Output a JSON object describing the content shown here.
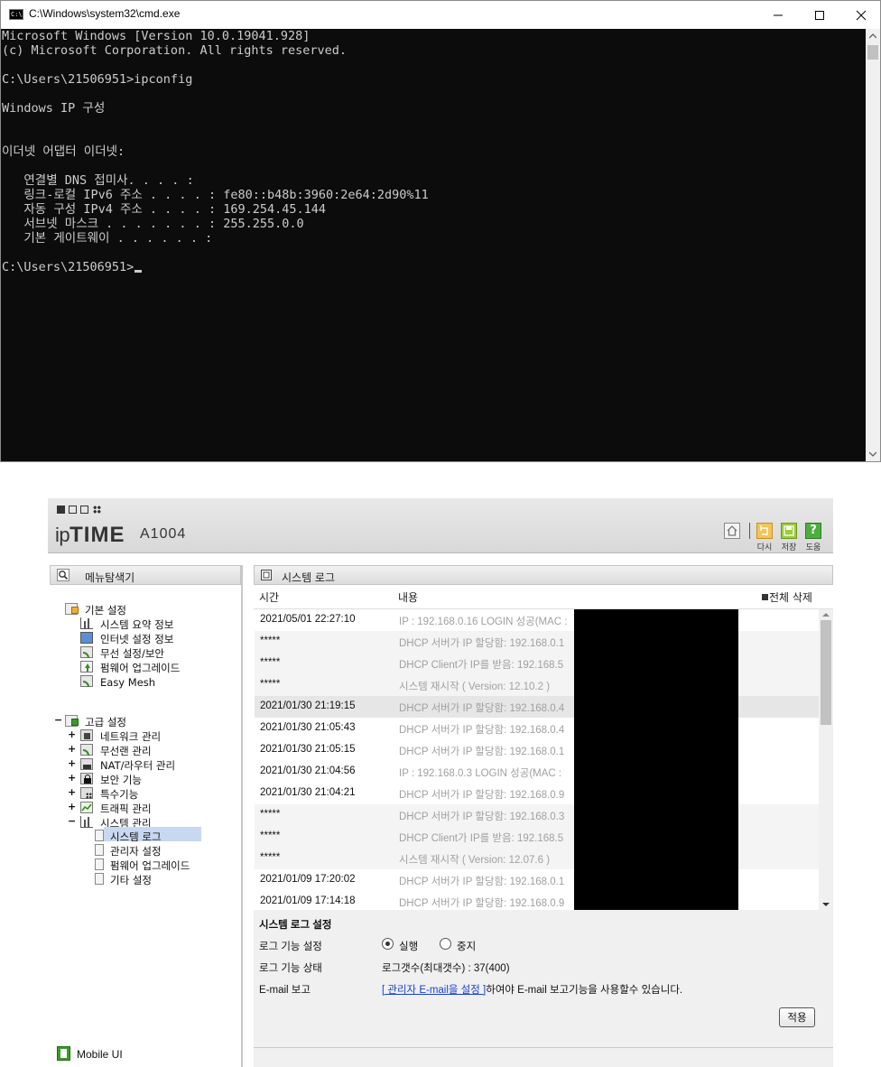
{
  "cmd": {
    "title": "C:\\Windows\\system32\\cmd.exe",
    "app_icon_text": "C:\\",
    "lines": [
      "Microsoft Windows [Version 10.0.19041.928]",
      "(c) Microsoft Corporation. All rights reserved.",
      "",
      "C:\\Users\\21506951>ipconfig",
      "",
      "Windows IP 구성",
      "",
      "",
      "이더넷 어댑터 이더넷:",
      "",
      "   연결별 DNS 접미사. . . . :",
      "   링크-로컬 IPv6 주소 . . . . : fe80::b48b:3960:2e64:2d90%11",
      "   자동 구성 IPv4 주소 . . . . : 169.254.45.144",
      "   서브넷 마스크 . . . . . . . : 255.255.0.0",
      "   기본 게이트웨이 . . . . . . :",
      ""
    ],
    "prompt": "C:\\Users\\21506951>"
  },
  "router": {
    "brand": "ipTIME",
    "brand_prefix": "ip",
    "brand_main": "TIME",
    "model": "A1004",
    "header_buttons": [
      "다시",
      "저장",
      "도움"
    ],
    "menu_title": "메뉴탐색기",
    "tree": {
      "basic": {
        "label": "기본 설정",
        "items": [
          "시스템 요약 정보",
          "인터넷 설정 정보",
          "무선 설정/보안",
          "펌웨어 업그레이드",
          "Easy Mesh"
        ]
      },
      "advanced": {
        "label": "고급 설정",
        "items": [
          "네트워크 관리",
          "무선랜 관리",
          "NAT/라우터 관리",
          "보안 기능",
          "특수기능",
          "트래픽 관리",
          "시스템 관리"
        ],
        "system_sub": [
          "시스템 로그",
          "관리자 설정",
          "펌웨어 업그레이드",
          "기타 설정"
        ]
      }
    },
    "mobile_ui": "Mobile UI",
    "log_title": "시스템 로그",
    "col_time": "시간",
    "col_content": "내용",
    "delete_all": "전체 삭제",
    "logs": [
      {
        "time": "2021/05/01 22:27:10",
        "msg": "IP : 192.168.0.16 LOGIN 성공(MAC :"
      },
      {
        "time": "*****",
        "msg": "DHCP 서버가 IP 할당함: 192.168.0.1"
      },
      {
        "time": "*****",
        "msg": "DHCP Client가 IP를 받음: 192.168.5"
      },
      {
        "time": "*****",
        "msg": "시스템 재시작 ( Version: 12.10.2 )"
      },
      {
        "time": "2021/01/30 21:19:15",
        "msg": "DHCP 서버가 IP 할당함: 192.168.0.4"
      },
      {
        "time": "2021/01/30 21:05:43",
        "msg": "DHCP 서버가 IP 할당함: 192.168.0.4"
      },
      {
        "time": "2021/01/30 21:05:15",
        "msg": "DHCP 서버가 IP 할당함: 192.168.0.1"
      },
      {
        "time": "2021/01/30 21:04:56",
        "msg": "IP : 192.168.0.3 LOGIN 성공(MAC :"
      },
      {
        "time": "2021/01/30 21:04:21",
        "msg": "DHCP 서버가 IP 할당함: 192.168.0.9"
      },
      {
        "time": "*****",
        "msg": "DHCP 서버가 IP 할당함: 192.168.0.3"
      },
      {
        "time": "*****",
        "msg": "DHCP Client가 IP를 받음: 192.168.5"
      },
      {
        "time": "*****",
        "msg": "시스템 재시작 ( Version: 12.07.6 )"
      },
      {
        "time": "2021/01/09 17:20:02",
        "msg": "DHCP 서버가 IP 할당함: 192.168.0.1"
      },
      {
        "time": "2021/01/09 17:14:18",
        "msg": "DHCP 서버가 IP 할당함: 192.168.0.9"
      }
    ],
    "settings": {
      "title": "시스템 로그 설정",
      "func_label": "로그 기능 설정",
      "run_label": "실행",
      "stop_label": "중지",
      "status_label": "로그 기능 상태",
      "status_value": "로그갯수(최대갯수) : 37(400)",
      "email_label": "E-mail 보고",
      "email_link": "[ 관리자 E-mail을 설정 ]",
      "email_text": "하여야 E-mail 보고기능을 사용할수 있습니다.",
      "apply": "적용"
    }
  }
}
